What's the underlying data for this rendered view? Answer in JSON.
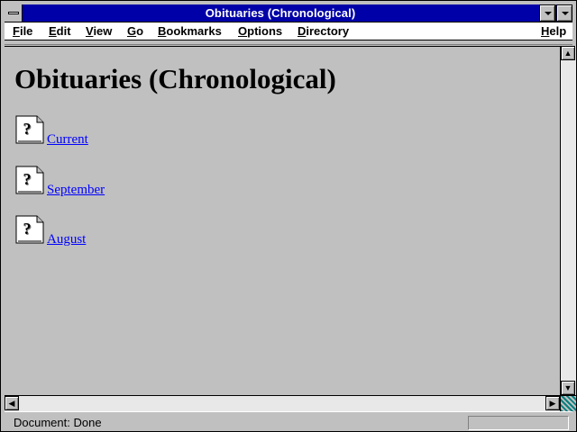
{
  "window": {
    "title": "Obituaries (Chronological)"
  },
  "menubar": {
    "items": [
      {
        "label": "File",
        "mnemonic": "F"
      },
      {
        "label": "Edit",
        "mnemonic": "E"
      },
      {
        "label": "View",
        "mnemonic": "V"
      },
      {
        "label": "Go",
        "mnemonic": "G"
      },
      {
        "label": "Bookmarks",
        "mnemonic": "B"
      },
      {
        "label": "Options",
        "mnemonic": "O"
      },
      {
        "label": "Directory",
        "mnemonic": "D"
      },
      {
        "label": "Help",
        "mnemonic": "H"
      }
    ]
  },
  "page": {
    "heading": "Obituaries (Chronological)",
    "links": [
      {
        "label": "Current",
        "icon": "unknown-document-icon"
      },
      {
        "label": "September",
        "icon": "unknown-document-icon"
      },
      {
        "label": "August",
        "icon": "unknown-document-icon"
      }
    ]
  },
  "status": {
    "text": "Document: Done"
  },
  "colors": {
    "titlebar": "#0000a8",
    "link": "#0000ff",
    "content_bg": "#c0c0c0",
    "desktop": "#008080"
  }
}
